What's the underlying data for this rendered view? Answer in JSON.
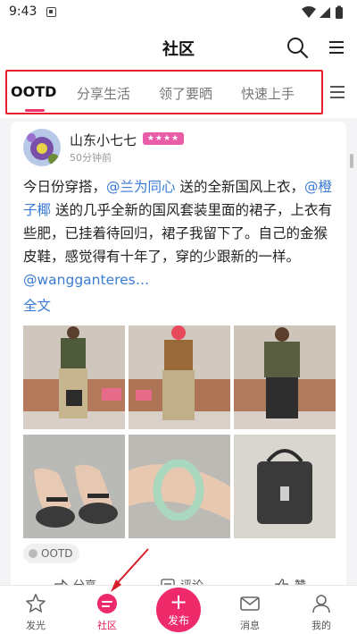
{
  "status_bar": {
    "time": "9:43"
  },
  "header": {
    "title": "社区"
  },
  "tabs": [
    {
      "label": "OOTD",
      "active": true
    },
    {
      "label": "分享生活",
      "active": false
    },
    {
      "label": "领了要晒",
      "active": false
    },
    {
      "label": "快速上手",
      "active": false
    }
  ],
  "post": {
    "author": "山东小七七",
    "level_badge": "★★★★",
    "time": "50分钟前",
    "text_parts": [
      {
        "text": "今日份穿搭，",
        "mention": false
      },
      {
        "text": "@兰为同心",
        "mention": true
      },
      {
        "text": " 送的全新国风上衣，",
        "mention": false
      },
      {
        "text": "@橙子椰",
        "mention": true
      },
      {
        "text": " 送的几乎全新的国风套装里面的裙子，上衣有些肥，已挂着待回归，裙子我留下了。自己的金猴皮鞋，感觉得有十年了，穿的少跟新的一样。",
        "mention": false
      },
      {
        "text": "@wangganteres…",
        "mention": true
      }
    ],
    "expand_label": "全文",
    "topic": "OOTD",
    "actions": {
      "share": "分享",
      "comment": "评论",
      "like": "赞"
    }
  },
  "bottom_nav": {
    "items": [
      {
        "label": "发光",
        "icon": "star-icon"
      },
      {
        "label": "社区",
        "icon": "chat-icon",
        "active": true
      },
      {
        "label": "消息",
        "icon": "mail-icon"
      },
      {
        "label": "我的",
        "icon": "person-icon"
      }
    ],
    "publish_label": "发布"
  },
  "colors": {
    "accent": "#ee2a6a",
    "mention": "#3a7bd5",
    "highlight_box": "#e8202a"
  }
}
